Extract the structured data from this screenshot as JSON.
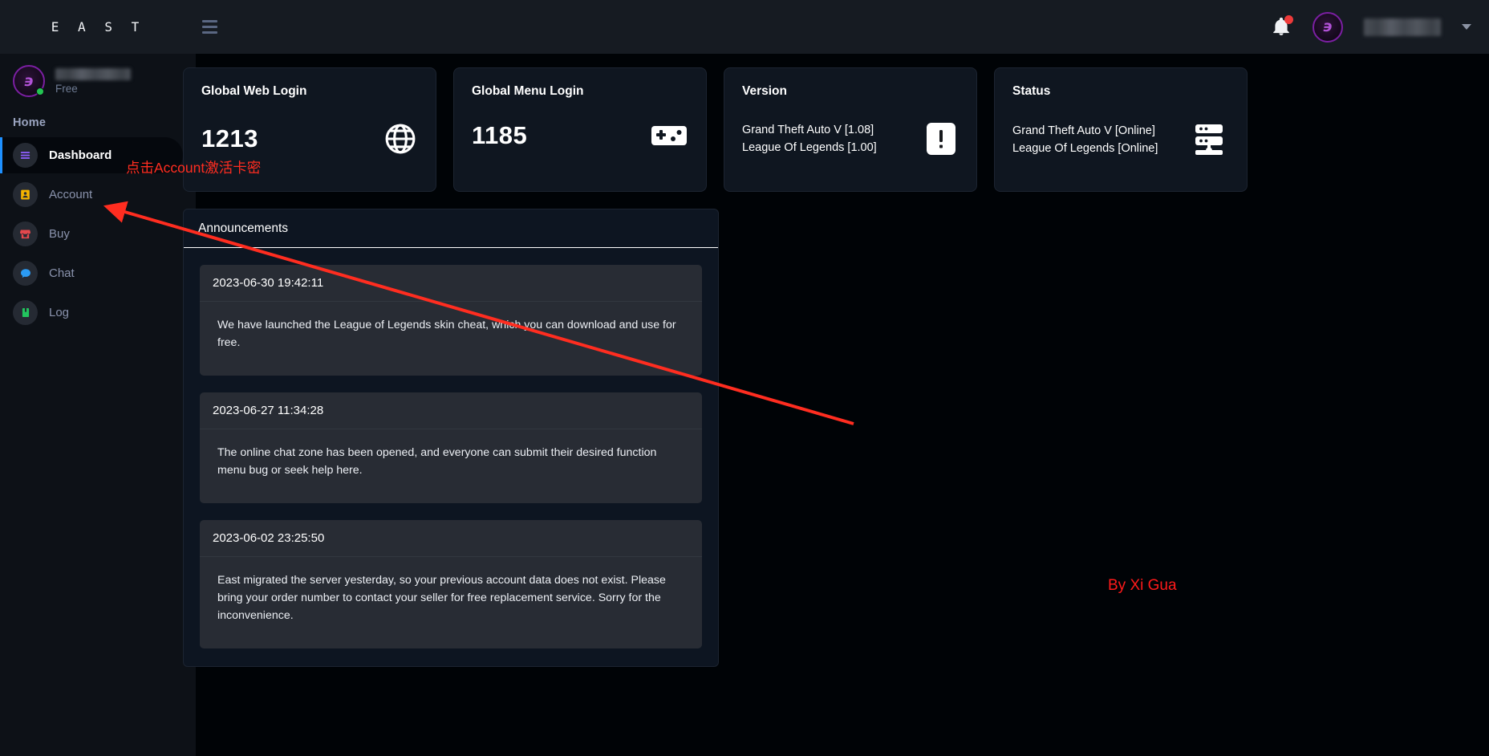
{
  "brand": {
    "logo_text": "E A S T"
  },
  "topbar": {
    "menu_toggle": "hamburger-menu",
    "notification_icon": "bell-icon",
    "has_notification": true,
    "account_name_redacted": true,
    "caret": "chevron-down-icon"
  },
  "sidebar": {
    "profile": {
      "plan": "Free",
      "name_redacted": true,
      "online": true
    },
    "section_title": "Home",
    "items": [
      {
        "label": "Dashboard",
        "icon": "list-icon",
        "icon_color": "#8b5cf6",
        "active": true
      },
      {
        "label": "Account",
        "icon": "id-card-icon",
        "icon_color": "#f5b400",
        "active": false
      },
      {
        "label": "Buy",
        "icon": "store-icon",
        "icon_color": "#e5484d",
        "active": false
      },
      {
        "label": "Chat",
        "icon": "chat-bubble-icon",
        "icon_color": "#2b9bf4",
        "active": false
      },
      {
        "label": "Log",
        "icon": "book-icon",
        "icon_color": "#22c55e",
        "active": false
      }
    ]
  },
  "cards": [
    {
      "title": "Global Web Login",
      "value": "1213",
      "icon": "globe-icon"
    },
    {
      "title": "Global Menu Login",
      "value": "1185",
      "icon": "gamepad-icon"
    },
    {
      "title": "Version",
      "lines": [
        "Grand Theft Auto V [1.08]",
        "League Of Legends [1.00]"
      ],
      "icon": "exclamation-icon"
    },
    {
      "title": "Status",
      "lines": [
        "Grand Theft Auto V [Online]",
        "League Of Legends [Online]"
      ],
      "icon": "server-icon"
    }
  ],
  "announcements_panel": {
    "title": "Announcements",
    "items": [
      {
        "date": "2023-06-30 19:42:11",
        "text": "We have launched the League of Legends skin cheat, which you can download and use for free."
      },
      {
        "date": "2023-06-27 11:34:28",
        "text": "The online chat zone has been opened, and everyone can submit their desired function menu bug or seek help here."
      },
      {
        "date": "2023-06-02 23:25:50",
        "text": "East migrated the server yesterday, so your previous account data does not exist. Please bring your order number to contact your seller for free replacement service. Sorry for the inconvenience."
      }
    ]
  },
  "annotations": {
    "instruction": "点击Account激活卡密",
    "watermark": "By Xi Gua",
    "arrow_color": "#ff2d20"
  }
}
